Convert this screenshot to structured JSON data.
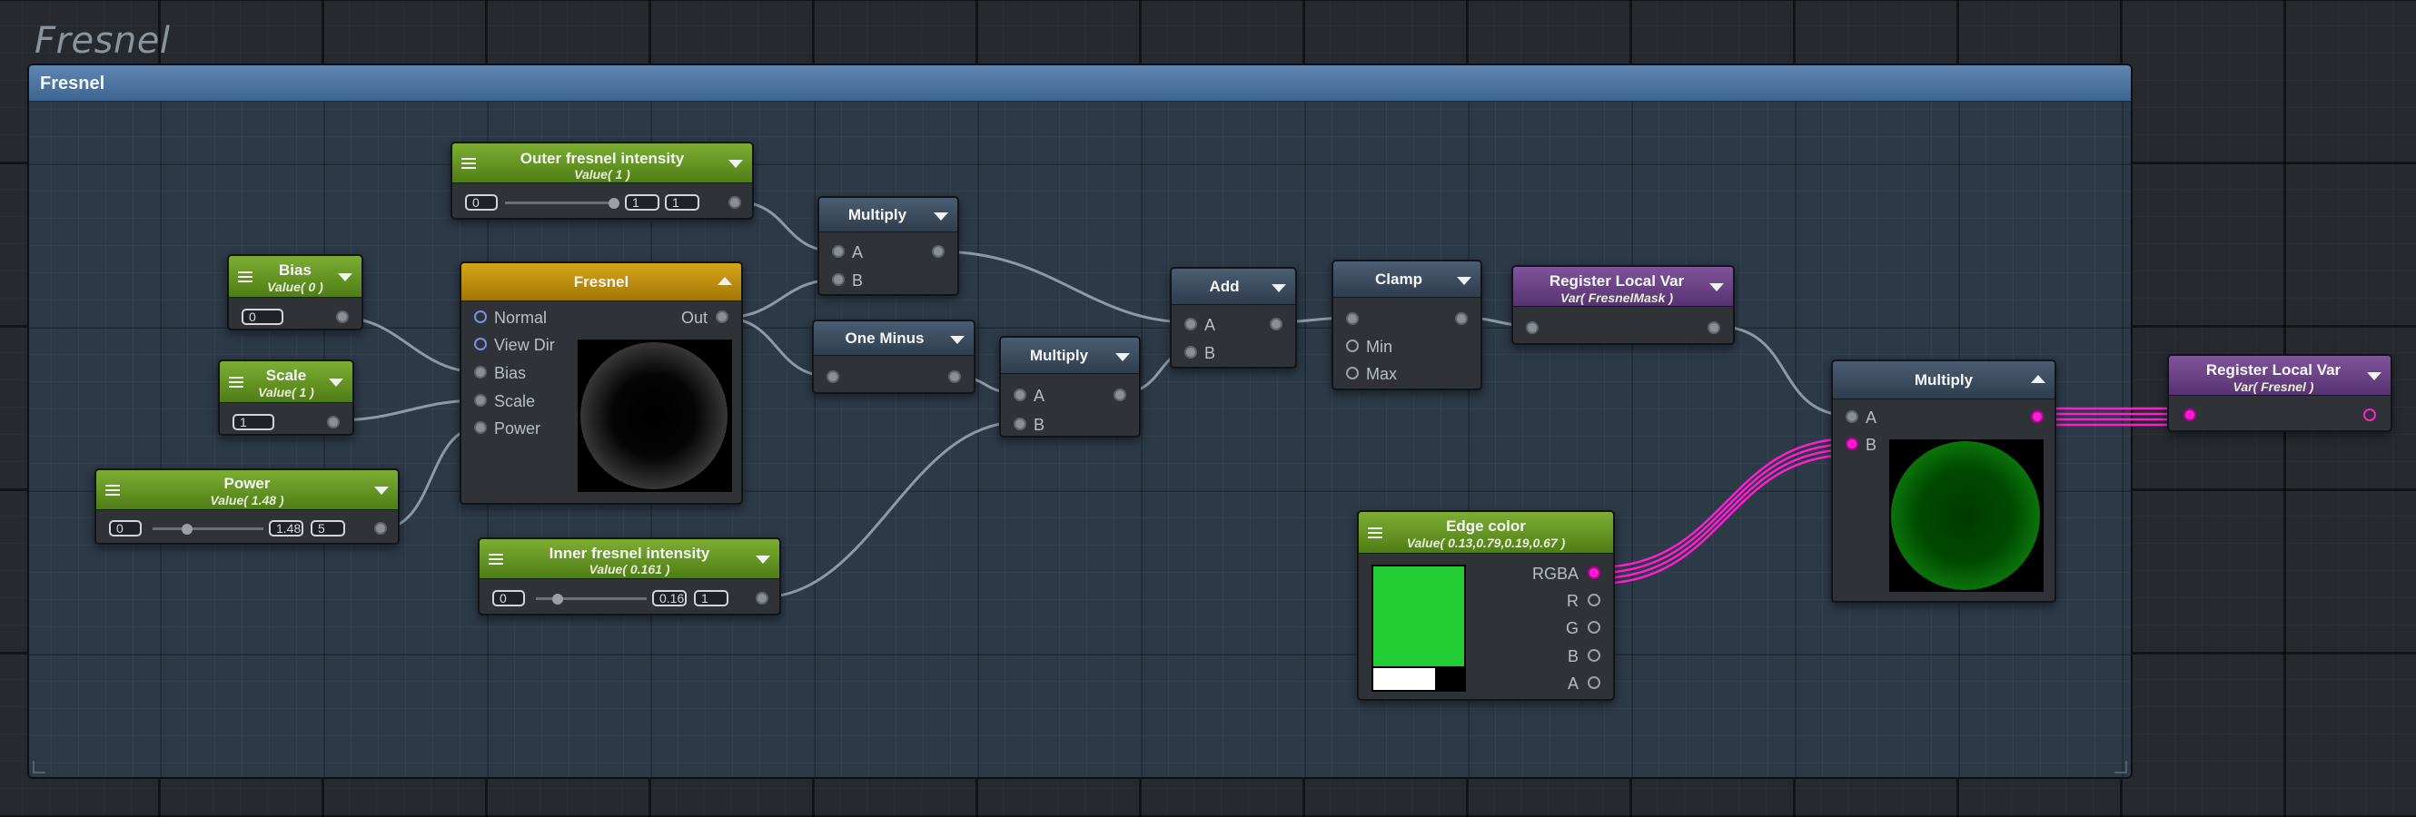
{
  "graph_title": "Fresnel",
  "group": {
    "title": "Fresnel"
  },
  "colors": {
    "green_preview": "#22cc33",
    "rgba_wire": "#ff1ecf",
    "wire": "#8d99a6"
  },
  "nodes": {
    "outer_fresnel": {
      "title": "Outer fresnel intensity",
      "subtitle": "Value( 1 )",
      "min": "0",
      "value": "1",
      "max": "1",
      "level": 1.0
    },
    "bias": {
      "title": "Bias",
      "subtitle": "Value( 0 )",
      "value": "0"
    },
    "scale": {
      "title": "Scale",
      "subtitle": "Value( 1 )",
      "value": "1"
    },
    "power": {
      "title": "Power",
      "subtitle": "Value( 1.48 )",
      "min": "0",
      "value": "1.48",
      "max": "5",
      "level": 0.296
    },
    "fresnel": {
      "title": "Fresnel",
      "inputs": [
        "Normal",
        "View Dir",
        "Bias",
        "Scale",
        "Power"
      ],
      "output": "Out"
    },
    "multiply1": {
      "title": "Multiply",
      "inputs": [
        "A",
        "B"
      ]
    },
    "one_minus": {
      "title": "One Minus"
    },
    "multiply2": {
      "title": "Multiply",
      "inputs": [
        "A",
        "B"
      ]
    },
    "inner_fresnel": {
      "title": "Inner fresnel intensity",
      "subtitle": "Value( 0.161 )",
      "min": "0",
      "value": "0.161",
      "max": "1",
      "level": 0.161
    },
    "add": {
      "title": "Add",
      "inputs": [
        "A",
        "B"
      ]
    },
    "clamp": {
      "title": "Clamp",
      "inputs": [
        "Min",
        "Max"
      ]
    },
    "register_mask": {
      "title": "Register Local Var",
      "subtitle": "Var( FresnelMask )"
    },
    "edge_color": {
      "title": "Edge color",
      "subtitle": "Value( 0.13,0.79,0.19,0.67 )",
      "outputs": [
        "RGBA",
        "R",
        "G",
        "B",
        "A"
      ]
    },
    "multiply3": {
      "title": "Multiply",
      "inputs": [
        "A",
        "B"
      ]
    },
    "register_fresnel": {
      "title": "Register Local Var",
      "subtitle": "Var( Fresnel )"
    }
  }
}
